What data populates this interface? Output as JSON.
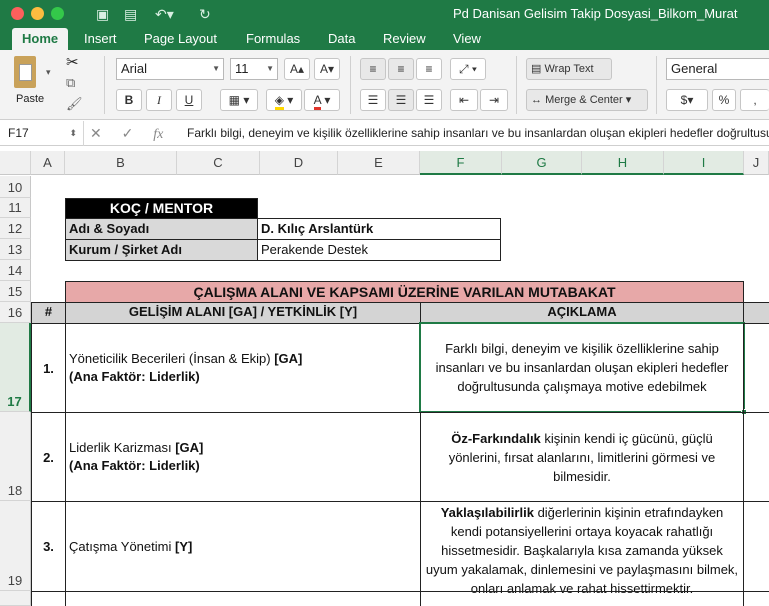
{
  "window": {
    "title": "Pd Danisan Gelisim Takip Dosyasi_Bilkom_Murat"
  },
  "tabs": [
    "Home",
    "Insert",
    "Page Layout",
    "Formulas",
    "Data",
    "Review",
    "View"
  ],
  "ribbon": {
    "paste_label": "Paste",
    "font_name": "Arial",
    "font_size": "11",
    "bold": "B",
    "italic": "I",
    "underline": "U",
    "wrap_text": "Wrap Text",
    "merge_center": "Merge & Center",
    "number_format": "General",
    "percent": "%"
  },
  "formula_bar": {
    "cell_ref": "F17",
    "fx": "fx",
    "content": "Farklı bilgi, deneyim ve kişilik özelliklerine sahip insanları ve bu insanlardan oluşan ekipleri hedefler doğrultusunda"
  },
  "columns": [
    "A",
    "B",
    "C",
    "D",
    "E",
    "F",
    "G",
    "H",
    "I",
    "J"
  ],
  "rows": [
    "10",
    "11",
    "12",
    "13",
    "14",
    "15",
    "16",
    "17",
    "18",
    "19"
  ],
  "sheet": {
    "koc_mentor": "KOÇ / MENTOR",
    "name_label": "Adı & Soyadı",
    "name_value": "D. Kılıç Arslantürk",
    "org_label": "Kurum / Şirket Adı",
    "org_value": "Perakende Destek",
    "section_title": "ÇALIŞMA ALANI VE KAPSAMI ÜZERİNE VARILAN MUTABAKAT",
    "col_num": "#",
    "col_area": "GELİŞİM ALANI [GA] / YETKİNLİK [Y]",
    "col_desc": "AÇIKLAMA",
    "items": [
      {
        "num": "1.",
        "area": "Yöneticilik Becerileri (İnsan & Ekip)",
        "tag": "[GA]",
        "factor": "(Ana Faktör: Liderlik)",
        "desc_lead": "",
        "desc": "Farklı bilgi, deneyim ve kişilik özelliklerine sahip insanları ve bu insanlardan oluşan ekipleri hedefler doğrultusunda çalışmaya motive edebilmek"
      },
      {
        "num": "2.",
        "area": "Liderlik Karizması",
        "tag": "[GA]",
        "factor": "(Ana Faktör: Liderlik)",
        "desc_lead": "Öz-Farkındalık",
        "desc": "kişinin kendi iç gücünü, güçlü yönlerini, fırsat alanlarını, limitlerini görmesi ve bilmesidir."
      },
      {
        "num": "3.",
        "area": "Çatışma Yönetimi",
        "tag": "[Y]",
        "factor": "",
        "desc_lead": "Yaklaşılabilirlik",
        "desc": "diğerlerinin kişinin etrafındayken kendi potansiyellerini ortaya koyacak rahatlığı hissetmesidir. Başkalarıyla kısa zamanda yüksek uyum yakalamak, dinlemesini ve paylaşmasını bilmek, onları anlamak ve rahat hissettirmektir."
      }
    ]
  },
  "colors": {
    "excel_green": "#1f7a45",
    "section_pink": "#e7a8a8",
    "header_gray": "#d4d4d4"
  }
}
